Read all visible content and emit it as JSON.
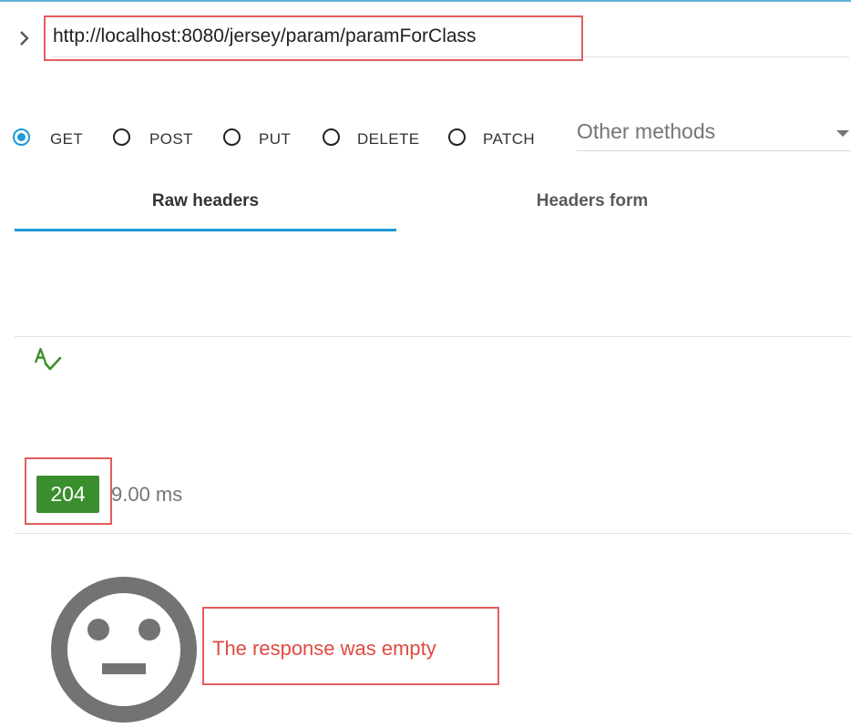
{
  "request": {
    "url": "http://localhost:8080/jersey/param/paramForClass",
    "methods": [
      {
        "label": "GET",
        "checked": true
      },
      {
        "label": "POST",
        "checked": false
      },
      {
        "label": "PUT",
        "checked": false
      },
      {
        "label": "DELETE",
        "checked": false
      },
      {
        "label": "PATCH",
        "checked": false
      }
    ],
    "other_methods_placeholder": "Other methods",
    "tabs": [
      {
        "label": "Raw headers",
        "active": true
      },
      {
        "label": "Headers form",
        "active": false
      }
    ]
  },
  "response": {
    "status_code": "204",
    "load_time": "9.00 ms",
    "empty_message": "The response was empty"
  },
  "colors": {
    "accent": "#1e9ad6",
    "status_success": "#3a8e2e",
    "highlight_box": "#e35d5b",
    "empty_text": "#e04a41"
  },
  "icons": {
    "url_toggle": "chevron-right-icon",
    "spellcheck": "spellcheck-icon",
    "empty_response": "neutral-face-icon",
    "dropdown": "caret-down-icon"
  }
}
